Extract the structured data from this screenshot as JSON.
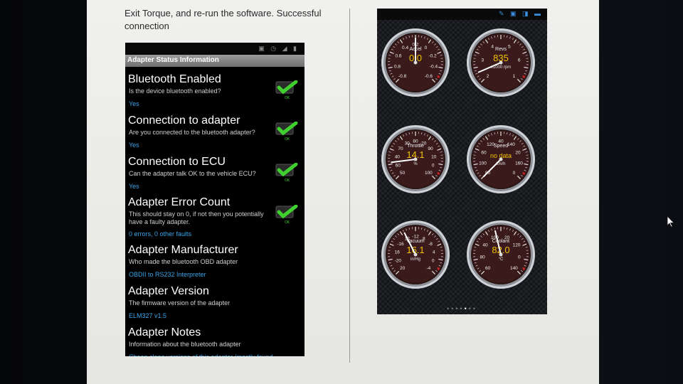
{
  "intro": {
    "text": "Exit Torque, and re-run the software. Successful connection"
  },
  "adapter_screen": {
    "header": "Adapter Status Information",
    "items": [
      {
        "title": "Bluetooth Enabled",
        "desc": "Is the device bluetooth enabled?",
        "value": "Yes",
        "ok": true
      },
      {
        "title": "Connection to adapter",
        "desc": "Are you connected to the bluetooth adapter?",
        "value": "Yes",
        "ok": true
      },
      {
        "title": "Connection to ECU",
        "desc": "Can the adapter talk OK to the vehicle ECU?",
        "value": "Yes",
        "ok": true
      },
      {
        "title": "Adapter Error Count",
        "desc": "This should stay on 0, if not then you potentially have a faulty adapter.",
        "value": "0 errors, 0 other faults",
        "ok": true
      },
      {
        "title": "Adapter Manufacturer",
        "desc": "Who made the bluetooth OBD adapter",
        "value": "OBDII to RS232 Interpreter",
        "ok": false
      },
      {
        "title": "Adapter Version",
        "desc": "The firmware version of the adapter",
        "value": "ELM327 v1.5",
        "ok": false
      },
      {
        "title": "Adapter Notes",
        "desc": "Information about the bluetooth adapter",
        "value": "Cheap clone versions of this adapter (mostly found",
        "ok": false
      }
    ],
    "check_label": "OK"
  },
  "gauges": [
    {
      "name": "Accel",
      "value": "0.0",
      "unit": "",
      "ticks": [
        "-0.8",
        "0.8",
        "0.6",
        "0.4",
        "0.2",
        "0",
        "-0.2",
        "-0.4",
        "-0.6"
      ],
      "level": 0.5
    },
    {
      "name": "Revs",
      "value": "835",
      "unit": "x1000 rpm",
      "ticks": [
        "2",
        "3",
        "4",
        "5",
        "6",
        "1"
      ],
      "level": 0.08
    },
    {
      "name": "Throttle",
      "value": "14.1",
      "unit": "%",
      "ticks": [
        "50",
        "60",
        "40",
        "70",
        "30",
        "80",
        "20",
        "90",
        "10",
        "0",
        "100"
      ],
      "level": 0.14
    },
    {
      "name": "Speed",
      "value": "no data",
      "unit": "km/h",
      "ticks": [
        "80",
        "100",
        "60",
        "120",
        "40",
        "140",
        "20",
        "160",
        "0"
      ],
      "level": 0
    },
    {
      "name": "Vacuum",
      "value": "16.1",
      "unit": "in/Hg",
      "ticks": [
        "20",
        "-20",
        "16",
        "-16",
        "12",
        "-12",
        "8",
        "-8",
        "4",
        "0",
        "-4"
      ],
      "level": 0.4
    },
    {
      "name": "Coolant",
      "value": "82.0",
      "unit": "°C",
      "ticks": [
        "60",
        "80",
        "40",
        "100",
        "20",
        "120",
        "0",
        "140"
      ],
      "level": 0.45
    }
  ],
  "page_indicator": {
    "count": 7,
    "active": 4
  },
  "colors": {
    "link_blue": "#3aa3e8",
    "check_green": "#3fcf2f",
    "gauge_value": "#f2c300",
    "needle": "#ffffff",
    "redline": "#d62020"
  }
}
